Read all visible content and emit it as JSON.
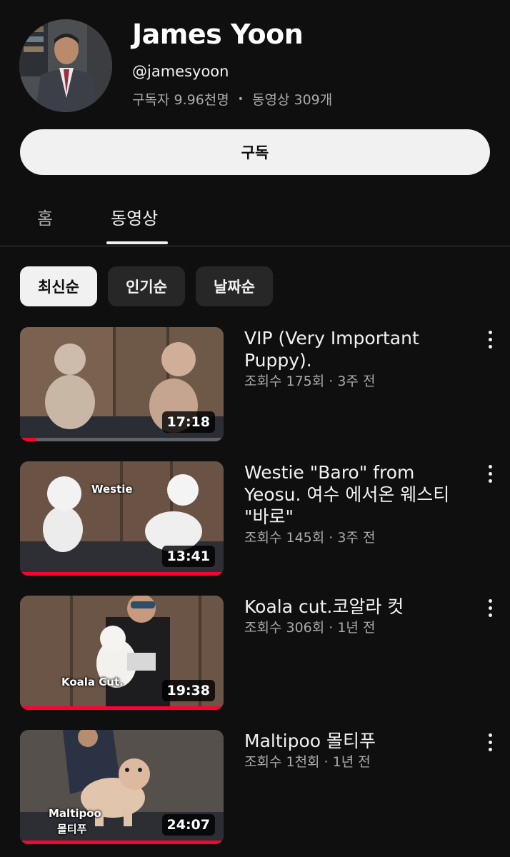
{
  "channel": {
    "name": "James Yoon",
    "handle": "@jamesyoon",
    "subscribers": "구독자 9.96천명",
    "separator": "•",
    "video_count": "동영상 309개",
    "subscribe_label": "구독"
  },
  "tabs": [
    {
      "label": "홈",
      "active": false
    },
    {
      "label": "동영상",
      "active": true
    }
  ],
  "chips": [
    {
      "label": "최신순",
      "selected": true
    },
    {
      "label": "인기순",
      "selected": false
    },
    {
      "label": "날짜순",
      "selected": false
    }
  ],
  "videos": [
    {
      "title": "VIP (Very Important Puppy).",
      "meta": "조회수 175회 · 3주 전",
      "duration": "17:18",
      "progress": 0.08,
      "caption": ""
    },
    {
      "title": "Westie \"Baro\" from Yeosu. 여수 에서온  웨스티 \"바로\"",
      "meta": "조회수 145회 · 3주 전",
      "duration": "13:41",
      "progress": 1.0,
      "caption": "Westie"
    },
    {
      "title": "Koala cut.코알라 컷",
      "meta": "조회수 306회 · 1년 전",
      "duration": "19:38",
      "progress": 1.0,
      "caption": "Koala Cut."
    },
    {
      "title": "Maltipoo 몰티푸",
      "meta": "조회수 1천회 · 1년 전",
      "duration": "24:07",
      "progress": 1.0,
      "caption_line1": "Maltipoo",
      "caption_line2": "몰티푸"
    }
  ],
  "colors": {
    "background": "#0f0f0f",
    "accent_progress": "#ff0033",
    "chip_bg": "#272727",
    "secondary_text": "#aaaaaa"
  }
}
